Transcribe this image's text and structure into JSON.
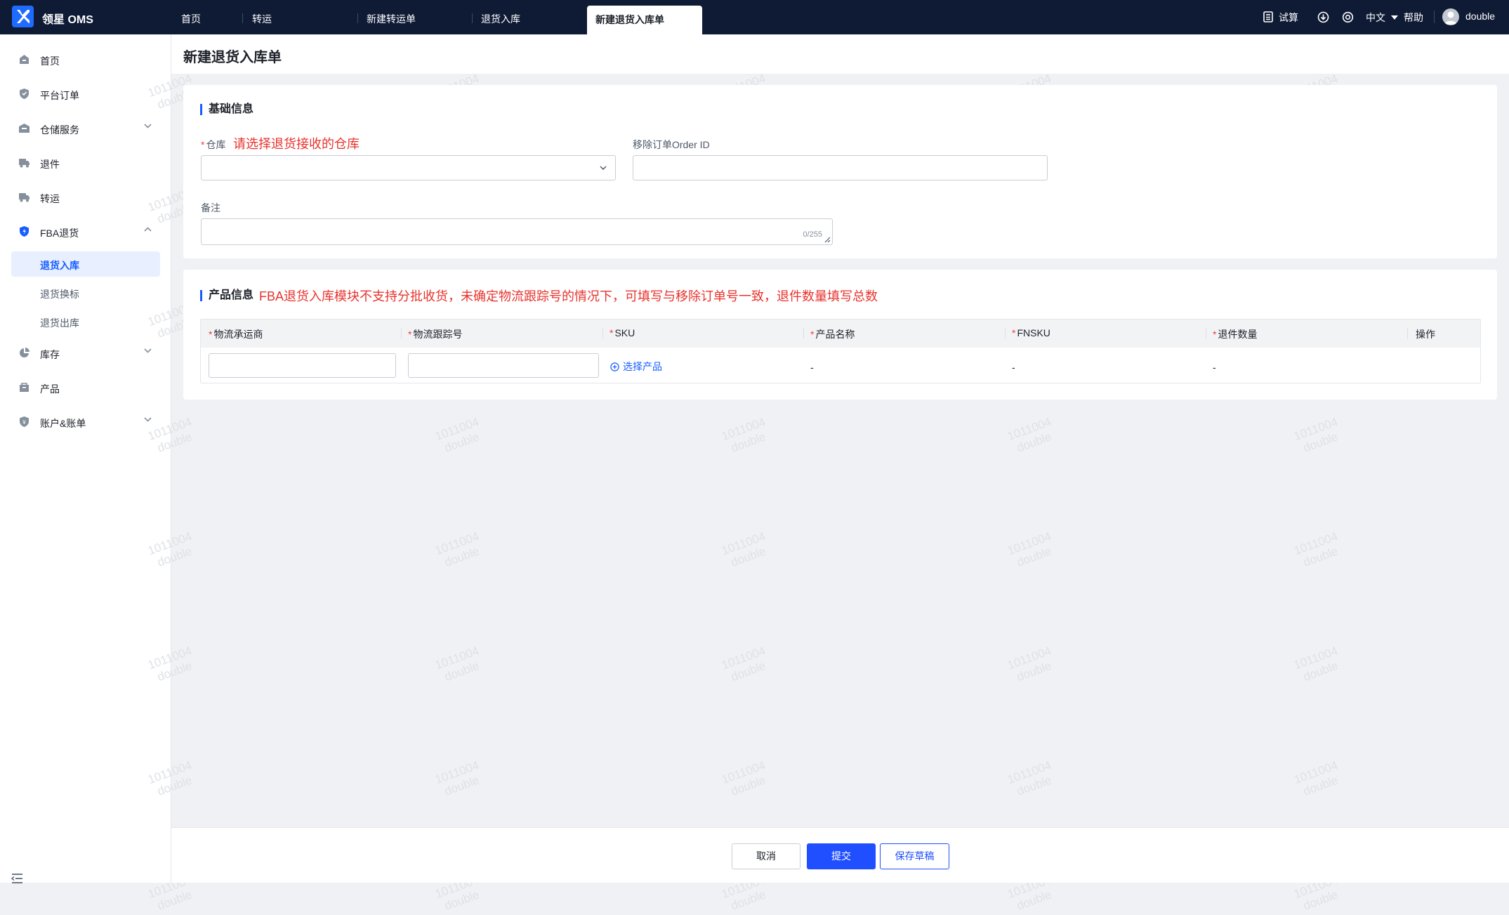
{
  "app": {
    "name": "领星 OMS"
  },
  "nav_tabs": [
    {
      "label": "首页"
    },
    {
      "label": "转运"
    },
    {
      "label": "新建转运单"
    },
    {
      "label": "退货入库"
    },
    {
      "label": "新建退货入库单",
      "active": true
    }
  ],
  "top_right": {
    "trial_label": "试算",
    "language": "中文",
    "help": "帮助",
    "user": "double"
  },
  "sidebar": {
    "items": [
      {
        "label": "首页",
        "icon": "home-icon"
      },
      {
        "label": "平台订单",
        "icon": "shield-icon"
      },
      {
        "label": "仓储服务",
        "icon": "warehouse-icon",
        "expandable": true
      },
      {
        "label": "退件",
        "icon": "truck-icon"
      },
      {
        "label": "转运",
        "icon": "truck-icon"
      },
      {
        "label": "FBA退货",
        "icon": "shield-icon",
        "expanded": true
      },
      {
        "label": "库存",
        "icon": "pie-chart-icon",
        "expandable": true
      },
      {
        "label": "产品",
        "icon": "box-icon"
      },
      {
        "label": "账户&账单",
        "icon": "shield-icon",
        "expandable": true
      }
    ],
    "fba_sub": [
      {
        "label": "退货入库",
        "active": true
      },
      {
        "label": "退货换标"
      },
      {
        "label": "退货出库"
      }
    ]
  },
  "page": {
    "title": "新建退货入库单"
  },
  "basic_info": {
    "title": "基础信息",
    "warehouse_label": "仓库",
    "warehouse_note": "请选择退货接收的仓库",
    "removal_order_label": "移除订单Order ID",
    "remark_label": "备注",
    "remark_counter": "0/255"
  },
  "product_info": {
    "title": "产品信息",
    "note": "FBA退货入库模块不支持分批收货，未确定物流跟踪号的情况下，可填写与移除订单号一致，退件数量填写总数",
    "columns": [
      "物流承运商",
      "物流跟踪号",
      "SKU",
      "产品名称",
      "FNSKU",
      "退件数量",
      "操作"
    ],
    "select_product": "选择产品",
    "row": {
      "product_name": "-",
      "fnsku": "-",
      "quantity": "-"
    }
  },
  "footer": {
    "cancel": "取消",
    "submit": "提交",
    "save_draft": "保存草稿"
  },
  "watermark": {
    "line1": "1011004",
    "line2": "double"
  },
  "colors": {
    "topbar": "#0f1b35",
    "primary": "#1f4fff",
    "note": "#e8322d"
  }
}
